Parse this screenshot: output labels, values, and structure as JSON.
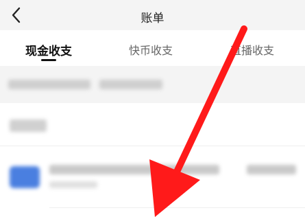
{
  "header": {
    "title": "账单",
    "back_icon": "chevron-left-icon"
  },
  "tabs": [
    {
      "label": "现金收支",
      "active": true
    },
    {
      "label": "快币收支",
      "active": false
    },
    {
      "label": "直播收支",
      "active": false
    }
  ],
  "colors": {
    "arrow": "#ff1a1a",
    "active_tab": "#111111",
    "inactive_tab": "#666666",
    "header_bg": "#f4f4f4"
  },
  "annotation": {
    "icon": "red-arrow-annotation"
  }
}
